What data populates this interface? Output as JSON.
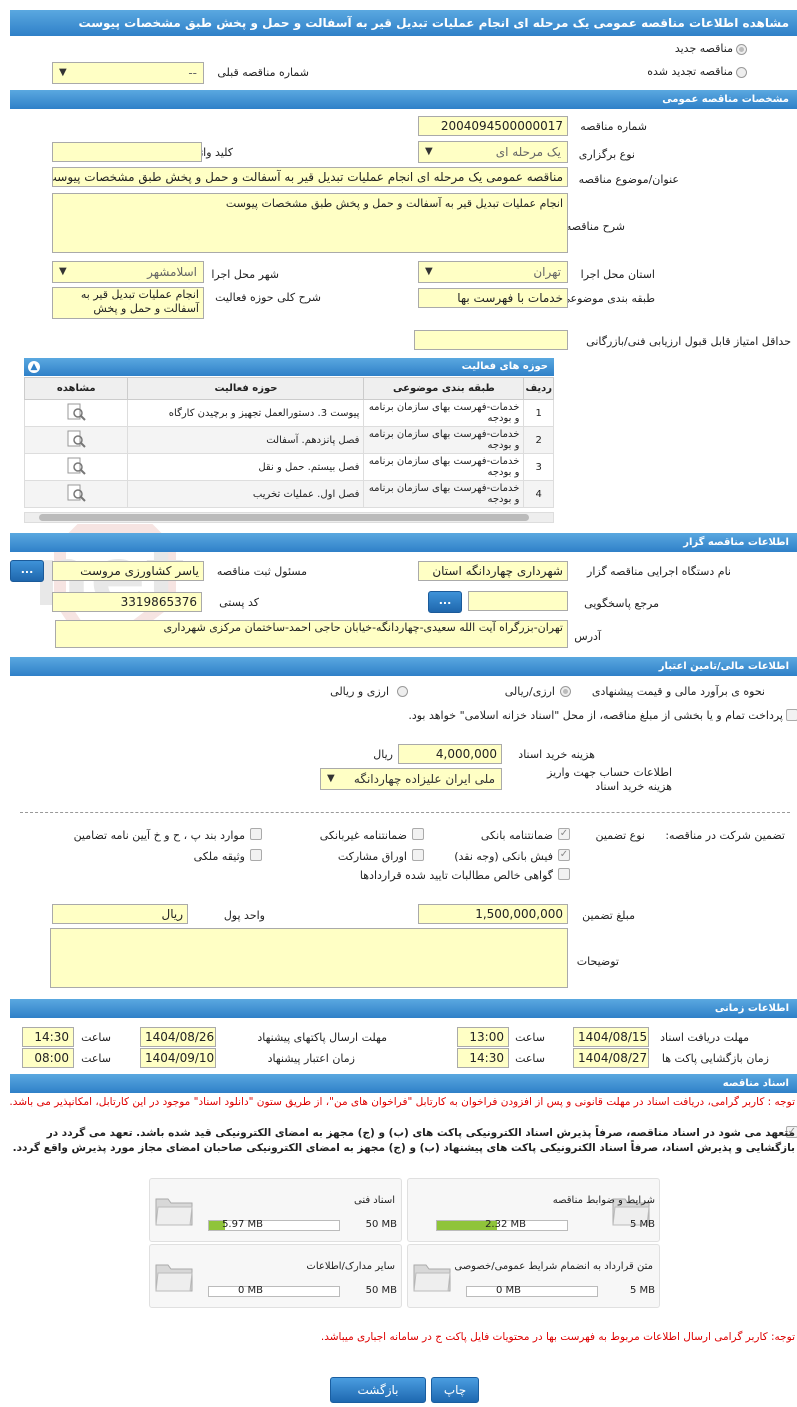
{
  "title": "مشاهده اطلاعات مناقصه عمومی یک مرحله ای انجام عملیات تبدیل قیر به آسفالت و حمل و پخش طبق مشخصات پیوست",
  "top": {
    "radio_new": "مناقصه جدید",
    "radio_renewed": "مناقصه تجدید شده",
    "prev_number_label": "شماره مناقصه قبلی",
    "prev_number_value": "--"
  },
  "general": {
    "header": "مشخصات مناقصه عمومی",
    "number_label": "شماره مناقصه",
    "number_value": "2004094500000017",
    "type_label": "نوع برگزاری",
    "type_value": "یک مرحله ای",
    "keyword_label": "کلید واژه",
    "keyword_value": "",
    "subject_label": "عنوان/موضوع مناقصه",
    "subject_value": "مناقصه عمومی یک مرحله ای انجام عملیات تبدیل قیر به آسفالت و حمل و پخش طبق مشخصات پیوست",
    "desc_label": "شرح مناقصه",
    "desc_value": "انجام عملیات تبدیل قیر به آسفالت و حمل و پخش طبق مشخصات پیوست",
    "province_label": "استان محل اجرا",
    "province_value": "تهران",
    "city_label": "شهر محل اجرا",
    "city_value": "اسلامشهر",
    "category_label": "طبقه بندی موضوعی",
    "category_value": "خدمات با فهرست بها",
    "scope_label": "شرح کلی حوزه فعالیت",
    "scope_value": "انجام عملیات تبدیل قیر به آسفالت و حمل و پخش",
    "min_score_label": "حداقل امتیاز قابل قبول ارزیابی فنی/بازرگانی",
    "min_score_value": ""
  },
  "activity": {
    "header": "حوزه های فعالیت",
    "columns": [
      "ردیف",
      "طبقه بندی موضوعی",
      "حوزه فعالیت",
      "مشاهده"
    ],
    "rows": [
      {
        "n": "1",
        "cat": "خدمات-فهرست بهای سازمان برنامه و بودجه",
        "area": "پیوست 3. دستورالعمل تجهیز و برچیدن کارگاه"
      },
      {
        "n": "2",
        "cat": "خدمات-فهرست بهای سازمان برنامه و بودجه",
        "area": "فصل پانزدهم. آسفالت"
      },
      {
        "n": "3",
        "cat": "خدمات-فهرست بهای سازمان برنامه و بودجه",
        "area": "فصل بیستم. حمل و نقل"
      },
      {
        "n": "4",
        "cat": "خدمات-فهرست بهای سازمان برنامه و بودجه",
        "area": "فصل اول. عملیات تخریب"
      }
    ]
  },
  "organizer": {
    "header": "اطلاعات مناقصه گزار",
    "org_label": "نام دستگاه اجرایی مناقصه گزار",
    "org_value": "شهرداری چهاردانگه استان",
    "responsible_label": "مسئول ثبت مناقصه",
    "responsible_value": "یاسر کشاورزی مروست",
    "ref_label": "مرجع پاسخگویی",
    "ref_value": "",
    "postal_label": "کد پستی",
    "postal_value": "3319865376",
    "address_label": "آدرس",
    "address_value": "تهران-بزرگراه آیت الله سعیدی-چهاردانگه-خیابان حاجی احمد-ساختمان مرکزی شهرداری",
    "dots": "..."
  },
  "finance": {
    "header": "اطلاعات مالی/تامین اعتبار",
    "estimate_label": "نحوه ی برآورد مالی و قیمت پیشنهادی",
    "opt_currency": "ارزی/ریالی",
    "opt_currency_rial": "ارزی و ریالی",
    "treasury_text": "پرداخت تمام و یا بخشی از مبلغ مناقصه، از محل \"اسناد خزانه اسلامی\" خواهد بود.",
    "doc_fee_label": "هزینه خرید اسناد",
    "doc_fee_value": "4,000,000",
    "doc_fee_unit": "ریال",
    "account_label": "اطلاعات حساب جهت واریز هزینه خرید اسناد",
    "account_value": "ملی ایران علیزاده چهاردانگه"
  },
  "guarantee": {
    "label": "تضمین شرکت در مناقصه:",
    "type_label": "نوع تضمین",
    "opts": {
      "bank": "ضمانتنامه بانکی",
      "nonbank": "ضمانتنامه غیربانکی",
      "clauses": "موارد بند پ ، ح و خ آیین نامه تضامین",
      "cheque": "فیش بانکی (وجه نقد)",
      "bonds": "اوراق مشارکت",
      "property": "وثیقه ملکی",
      "claims": "گواهی خالص مطالبات تایید شده قراردادها"
    },
    "amount_label": "مبلغ تضمین",
    "amount_value": "1,500,000,000",
    "currency_label": "واحد پول",
    "currency_value": "ریال",
    "notes_label": "توضیحات"
  },
  "timing": {
    "header": "اطلاعات زمانی",
    "receive_label": "مهلت دریافت اسناد",
    "receive_date": "1404/08/15",
    "receive_time": "13:00",
    "send_label": "مهلت ارسال پاکتهای پیشنهاد",
    "send_date": "1404/08/26",
    "send_time": "14:30",
    "open_label": "زمان بازگشایی پاکت ها",
    "open_date": "1404/08/27",
    "open_time": "14:30",
    "valid_label": "زمان اعتبار پیشنهاد",
    "valid_date": "1404/09/10",
    "valid_time": "08:00",
    "time_label": "ساعت"
  },
  "docs": {
    "header": "اسناد مناقصه",
    "notice1": "توجه : کاربر گرامی، دریافت اسناد در مهلت قانونی و پس از افزودن فراخوان به کارتابل \"فراخوان های من\"، از طریق ستون \"دانلود اسناد\" موجود در این کارتابل، امکانپذیر می باشد.",
    "commit": "متعهد می شود در اسناد مناقصه، صرفاً پذیرش اسناد الکترونیکی پاکت های (ب) و (ج) مجهز به امضای الکترونیکی قید شده باشد. تعهد می گردد در بازگشایی و پذیرش اسناد، صرفاً اسناد الکترونیکی پاکت های پیشنهاد (ب) و (ج) مجهز به امضای الکترونیکی صاحبان امضای مجاز مورد پذیرش واقع گردد.",
    "cards": [
      {
        "title": "شرایط و ضوابط مناقصه",
        "used": "2.32 MB",
        "max": "5 MB",
        "fill": 0.46
      },
      {
        "title": "اسناد فنی",
        "used": "5.97 MB",
        "max": "50 MB",
        "fill": 0.12
      },
      {
        "title": "متن قرارداد به انضمام شرایط عمومی/خصوصی",
        "used": "0 MB",
        "max": "5 MB",
        "fill": 0
      },
      {
        "title": "سایر مدارک/اطلاعات",
        "used": "0 MB",
        "max": "50 MB",
        "fill": 0
      }
    ],
    "notice2": "توجه: کاربر گرامی ارسال اطلاعات مربوط به فهرست بها در محتویات فایل پاکت ج در سامانه اجباری میباشد."
  },
  "buttons": {
    "print": "چاپ",
    "back": "بازگشت"
  },
  "colors": {
    "header": "#2f80c8",
    "field": "#ffffc5",
    "notice": "#dd0000",
    "progress": "#8fc43a"
  }
}
